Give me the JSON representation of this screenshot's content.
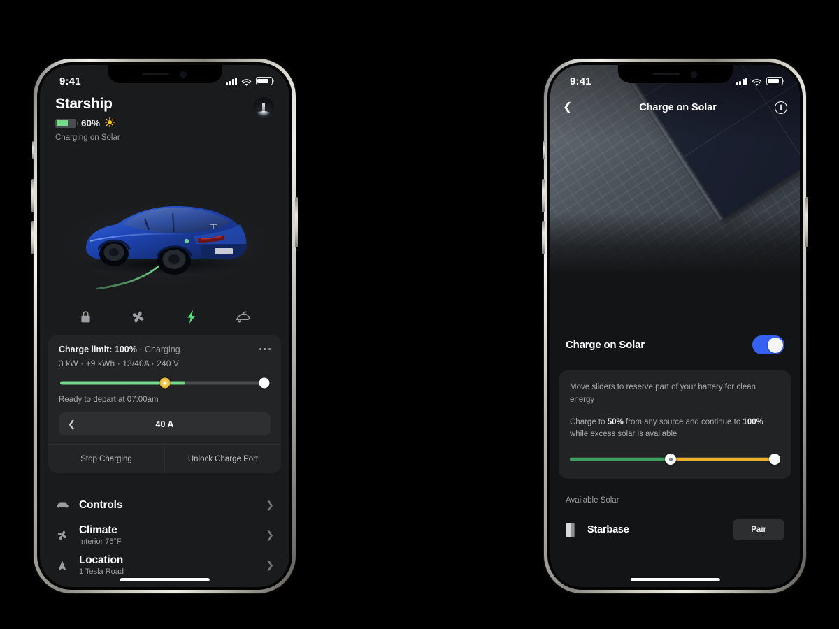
{
  "meta": {
    "accent_blue": "#3461f0",
    "accent_green": "#74d98a",
    "accent_amber": "#edb22c",
    "bg": "#000000"
  },
  "left_phone": {
    "status_bar": {
      "time": "9:41",
      "signal_icon": "signal-bars-icon",
      "wifi_icon": "wifi-icon",
      "battery_icon": "battery-icon"
    },
    "header": {
      "vehicle_name": "Starship",
      "battery_percent": "60%",
      "battery_fill": 60,
      "solar_icon": "sun-icon",
      "status": "Charging on Solar",
      "avatar_name": "starship-avatar"
    },
    "vehicle_image": "blue-tesla-model-s-rear-three-quarter-with-green-charge-cable",
    "quick_actions": [
      {
        "name": "lock-icon",
        "label": "Lock",
        "active": false
      },
      {
        "name": "fan-icon",
        "label": "Climate",
        "active": false
      },
      {
        "name": "charging-bolt-icon",
        "label": "Charging",
        "active": true
      },
      {
        "name": "trunk-icon",
        "label": "Trunk",
        "active": false
      }
    ],
    "charge_card": {
      "limit_label": "Charge limit: 100%",
      "separator": "·",
      "state": "Charging",
      "overflow_icon": "more-options-icon",
      "metrics": "3 kW · +9 kWh · 13/40A · 240 V",
      "slider": {
        "fill_percent": 60,
        "sun_position_percent": 50,
        "knob_position_percent": 100
      },
      "ready_text": "Ready to depart at 07:00am",
      "amperage_value": "40 A",
      "amperage_chevron": "chevron-left-icon",
      "actions": [
        "Stop Charging",
        "Unlock Charge Port"
      ]
    },
    "menu": [
      {
        "icon": "car-icon",
        "title": "Controls",
        "subtitle": "",
        "chevron": "chevron-right-icon"
      },
      {
        "icon": "fan-icon",
        "title": "Climate",
        "subtitle": "Interior 75°F",
        "chevron": "chevron-right-icon"
      },
      {
        "icon": "navigation-arrow-icon",
        "title": "Location",
        "subtitle": "1 Tesla Road",
        "chevron": "chevron-right-icon"
      }
    ]
  },
  "right_phone": {
    "status_bar": {
      "time": "9:41",
      "signal_icon": "signal-bars-icon",
      "wifi_icon": "wifi-icon",
      "battery_icon": "battery-icon"
    },
    "navbar": {
      "back_icon": "chevron-left-icon",
      "title": "Charge on Solar",
      "info_icon": "info-icon",
      "info_glyph": "i"
    },
    "hero_image": "solar-roof-tiles-on-shingle-roof",
    "toggle": {
      "label": "Charge on Solar",
      "state": "on"
    },
    "info_card": {
      "line1": "Move sliders to reserve part of your battery for clean energy",
      "line2_pre": "Charge to ",
      "line2_bold1": "50%",
      "line2_mid": " from any source and continue to ",
      "line2_bold2": "100%",
      "line2_post": " while excess solar is available",
      "slider": {
        "green_end_percent": 48,
        "amber_end_percent": 100,
        "sun_position_percent": 48,
        "knob_position_percent": 100
      }
    },
    "section_label": "Available Solar",
    "solar_device": {
      "icon": "powerwall-icon",
      "name": "Starbase",
      "action_label": "Pair"
    }
  }
}
